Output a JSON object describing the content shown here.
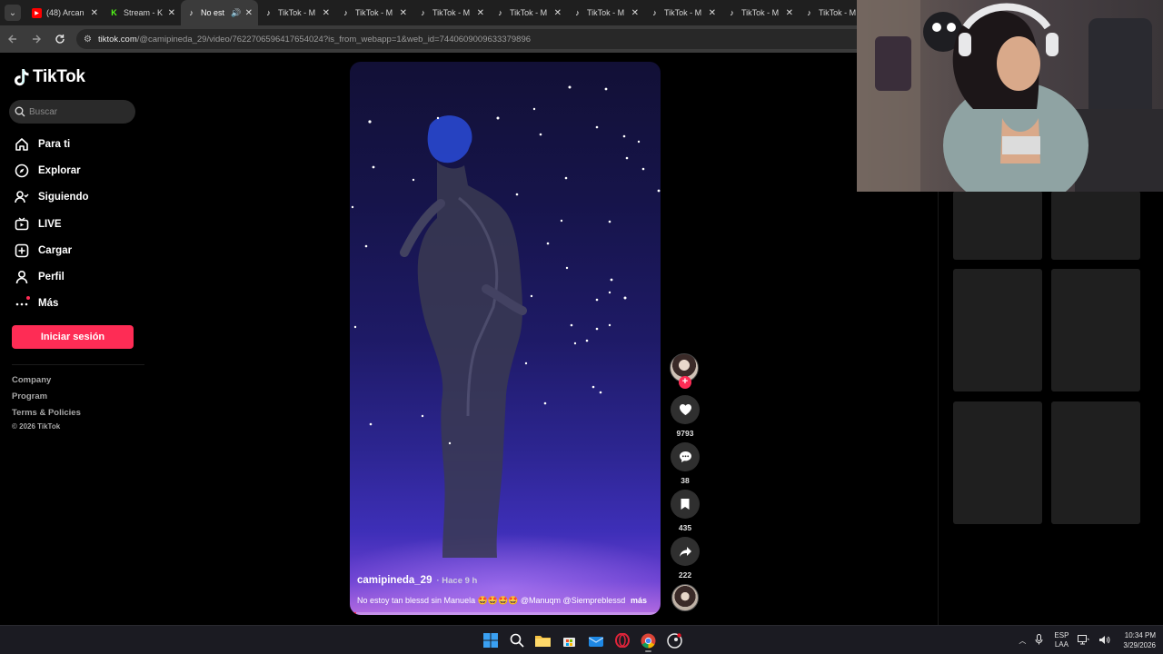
{
  "browser": {
    "tabs": [
      {
        "title": "(48) Arcan",
        "icon": "youtube-icon",
        "active": false
      },
      {
        "title": "Stream - K",
        "icon": "kick-icon",
        "active": false
      },
      {
        "title": "No est",
        "icon": "tiktok-icon",
        "active": true,
        "audio": true
      },
      {
        "title": "TikTok - M",
        "icon": "tiktok-icon",
        "active": false
      },
      {
        "title": "TikTok - M",
        "icon": "tiktok-icon",
        "active": false
      },
      {
        "title": "TikTok - M",
        "icon": "tiktok-icon",
        "active": false
      },
      {
        "title": "TikTok - M",
        "icon": "tiktok-icon",
        "active": false
      },
      {
        "title": "TikTok - M",
        "icon": "tiktok-icon",
        "active": false
      },
      {
        "title": "TikTok - M",
        "icon": "tiktok-icon",
        "active": false
      },
      {
        "title": "TikTok - M",
        "icon": "tiktok-icon",
        "active": false
      },
      {
        "title": "TikTok - M",
        "icon": "tiktok-icon",
        "active": false
      }
    ],
    "url_host": "tiktok.com",
    "url_path": "/@camipineda_29/video/7622706596417654024?is_from_webapp=1&web_id=7440609009633379896"
  },
  "sidebar": {
    "logo": "TikTok",
    "search_placeholder": "Buscar",
    "nav": [
      {
        "label": "Para ti",
        "icon": "home-icon"
      },
      {
        "label": "Explorar",
        "icon": "compass-icon"
      },
      {
        "label": "Siguiendo",
        "icon": "following-icon"
      },
      {
        "label": "LIVE",
        "icon": "live-icon"
      },
      {
        "label": "Cargar",
        "icon": "upload-icon"
      },
      {
        "label": "Perfil",
        "icon": "profile-icon"
      },
      {
        "label": "Más",
        "icon": "more-icon"
      }
    ],
    "login_label": "Iniciar sesión",
    "footer_links": [
      "Company",
      "Program",
      "Terms & Policies"
    ],
    "copyright": "© 2026 TikTok"
  },
  "video": {
    "username": "camipineda_29",
    "posted": "· Hace 9 h",
    "description": "No estoy tan blessd sin Manuela 🤩🤩🤩🤩 @Manuqm @Siempreblessd",
    "more_label": "más",
    "progress": 0.02
  },
  "actions": {
    "likes": "9793",
    "comments": "38",
    "saves": "435",
    "shares": "222"
  },
  "taskbar": {
    "lang_top": "ESP",
    "lang_bottom": "LAA",
    "time": "10:34 PM",
    "date": "3/29/2026"
  },
  "colors": {
    "accent": "#fe2c55",
    "background": "#000000",
    "chrome_tabbar": "#1f1f1f",
    "chrome_toolbar": "#3b3b3b"
  }
}
